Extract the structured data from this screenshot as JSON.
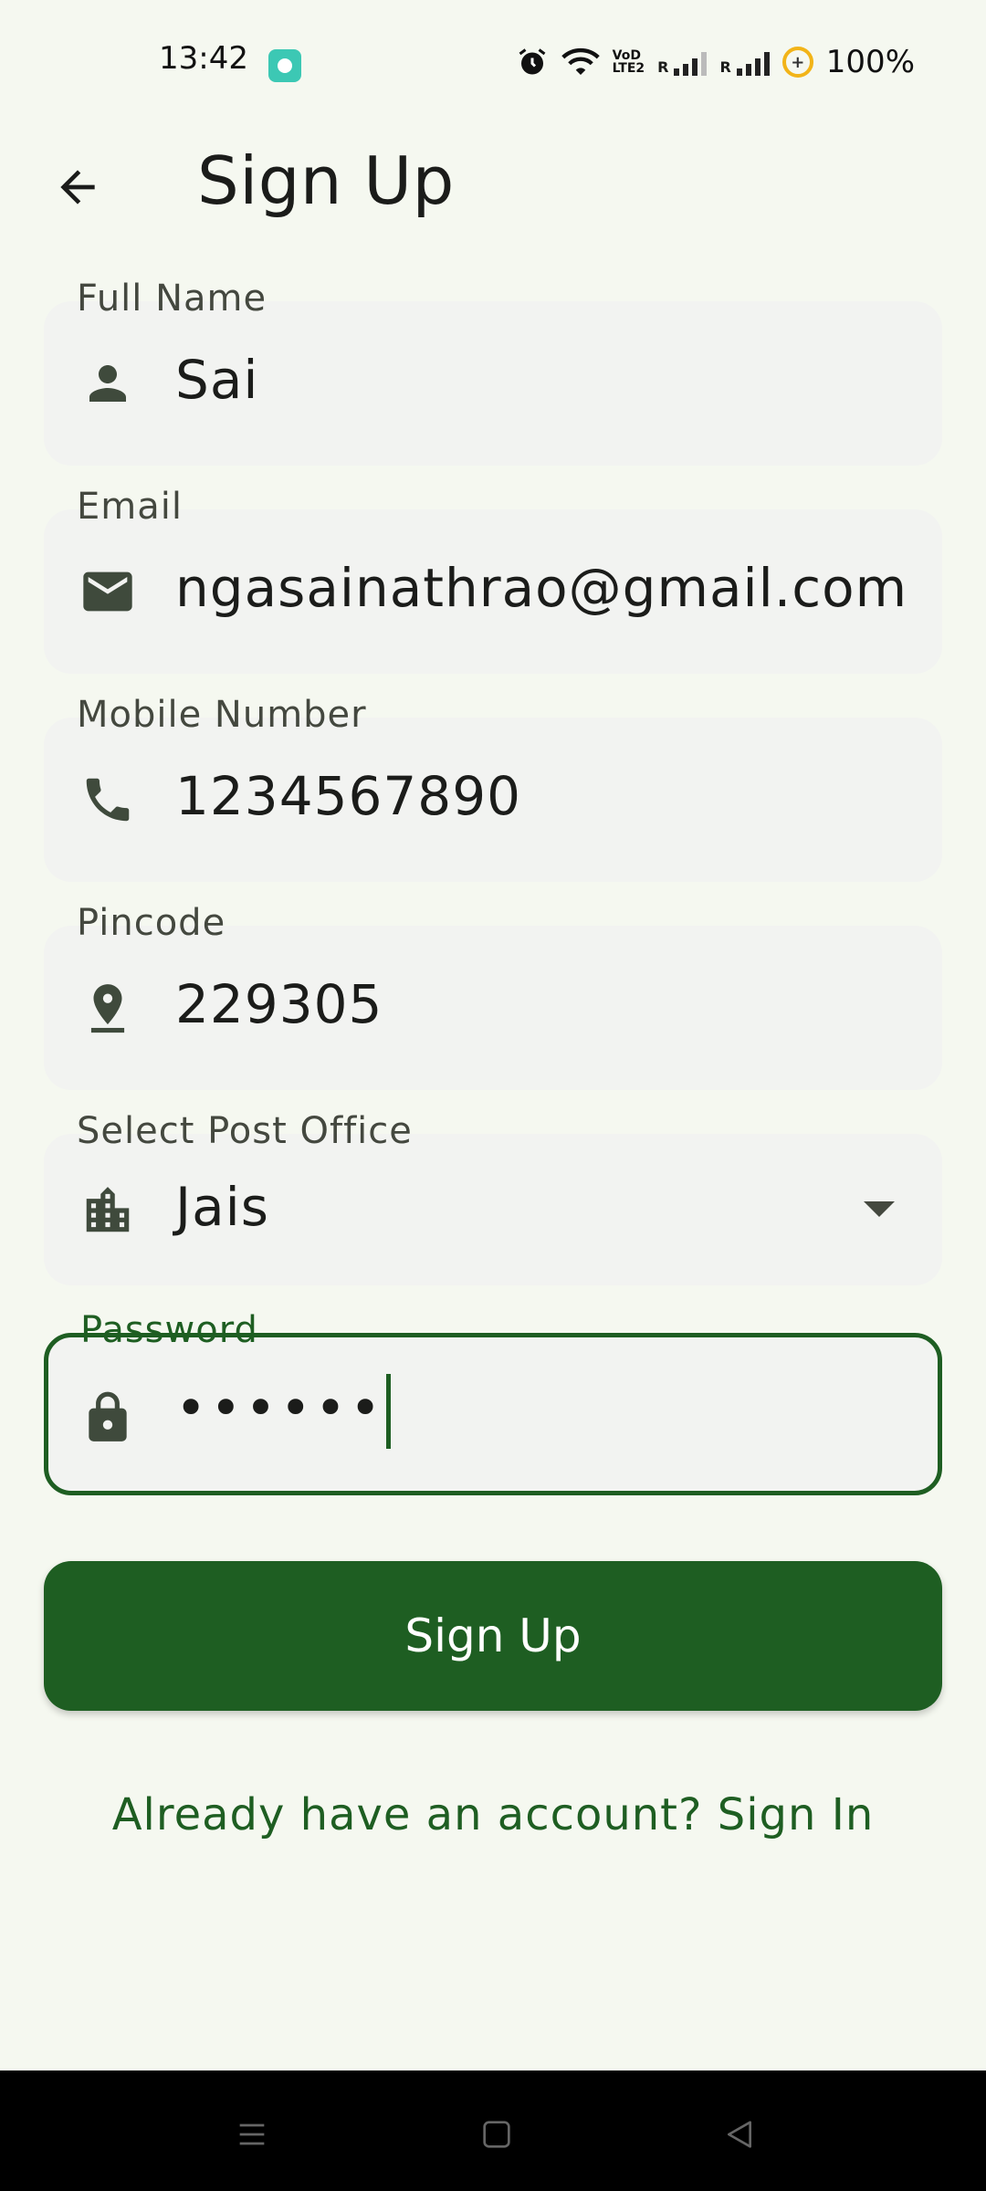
{
  "status": {
    "time": "13:42",
    "battery": "100%",
    "volte": [
      "VoD",
      "LTE2"
    ],
    "signal_label": "R"
  },
  "header": {
    "title": "Sign Up",
    "back_icon": "arrow-left-icon"
  },
  "form": {
    "full_name": {
      "label": "Full Name",
      "value": "Sai",
      "icon": "person-icon"
    },
    "email": {
      "label": "Email",
      "value": "ngasainathrao@gmail.com",
      "icon": "mail-icon"
    },
    "mobile": {
      "label": "Mobile Number",
      "value": "1234567890",
      "icon": "phone-icon"
    },
    "pincode": {
      "label": "Pincode",
      "value": "229305",
      "icon": "location-pin-icon"
    },
    "post_office": {
      "label": "Select Post Office",
      "value": "Jais",
      "icon": "building-icon"
    },
    "password": {
      "label": "Password",
      "value": "••••••",
      "icon": "lock-icon"
    }
  },
  "actions": {
    "signup_label": "Sign Up",
    "signin_link": "Already have an account? Sign In"
  },
  "colors": {
    "primary": "#1e5e22",
    "background": "#f5f8f0",
    "field_bg": "#f2f3f1"
  }
}
